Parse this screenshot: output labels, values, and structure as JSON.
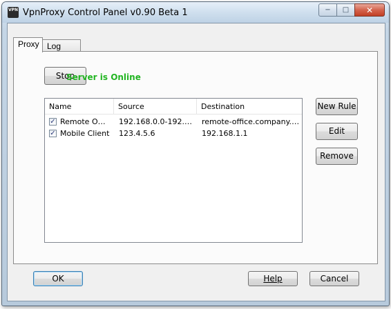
{
  "window": {
    "title": "VpnProxy Control Panel v0.90 Beta 1",
    "icon_text": "VPN"
  },
  "caption_buttons": {
    "minimize": "−",
    "maximize": "□",
    "close": "✕"
  },
  "tabs": [
    {
      "label": "Proxy",
      "active": true
    },
    {
      "label": "Log",
      "active": false
    }
  ],
  "proxy": {
    "stop_button": "Stop",
    "status_text": "Server is Online",
    "status_color": "#22b522",
    "columns": [
      "Name",
      "Source",
      "Destination"
    ],
    "rules": [
      {
        "checked": true,
        "name": "Remote Office",
        "source": "192.168.0.0-192.1...",
        "destination": "remote-office.company.com"
      },
      {
        "checked": true,
        "name": "Mobile Client",
        "source": "123.4.5.6",
        "destination": "192.168.1.1"
      }
    ],
    "new_rule_button": "New Rule",
    "edit_button": "Edit",
    "remove_button": "Remove"
  },
  "footer": {
    "ok_button": "OK",
    "help_button": "Help",
    "cancel_button": "Cancel"
  }
}
